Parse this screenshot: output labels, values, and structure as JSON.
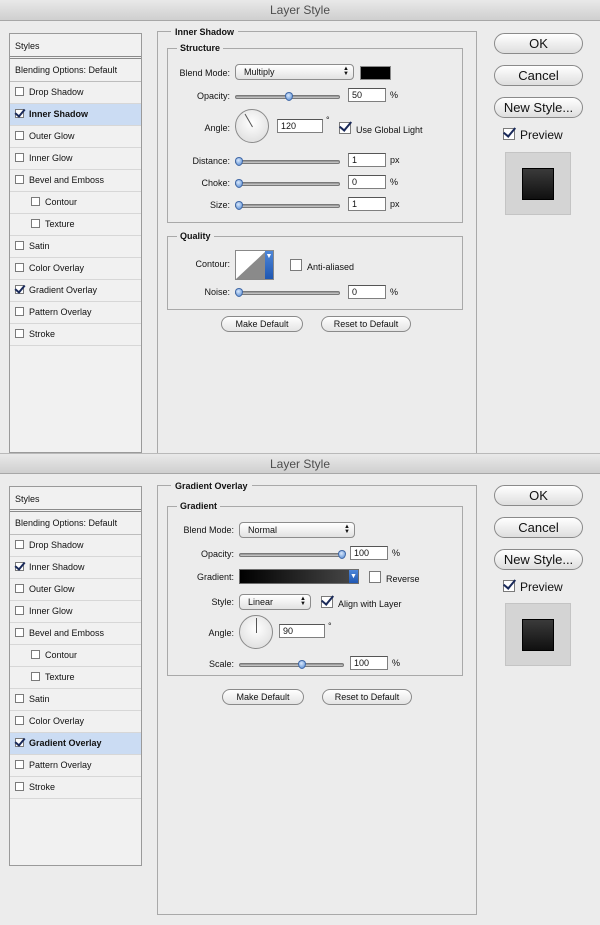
{
  "dialog1": {
    "title": "Layer Style",
    "styles": {
      "header": "Styles",
      "blending": "Blending Options: Default",
      "items": [
        {
          "label": "Drop Shadow",
          "checked": false
        },
        {
          "label": "Inner Shadow",
          "checked": true
        },
        {
          "label": "Outer Glow",
          "checked": false
        },
        {
          "label": "Inner Glow",
          "checked": false
        },
        {
          "label": "Bevel and Emboss",
          "checked": false
        },
        {
          "label": "Contour",
          "checked": false
        },
        {
          "label": "Texture",
          "checked": false
        },
        {
          "label": "Satin",
          "checked": false
        },
        {
          "label": "Color Overlay",
          "checked": false
        },
        {
          "label": "Gradient Overlay",
          "checked": true
        },
        {
          "label": "Pattern Overlay",
          "checked": false
        },
        {
          "label": "Stroke",
          "checked": false
        }
      ]
    },
    "panel_title": "Inner Shadow",
    "structure": {
      "title": "Structure",
      "blend_mode_label": "Blend Mode:",
      "blend_mode": "Multiply",
      "shadow_color": "#000000",
      "opacity_label": "Opacity:",
      "opacity": "50",
      "opacity_unit": "%",
      "opacity_value": 50,
      "angle_label": "Angle:",
      "angle": "120",
      "angle_unit": "°",
      "use_global_light": "Use Global Light",
      "distance_label": "Distance:",
      "distance": "1",
      "distance_unit": "px",
      "choke_label": "Choke:",
      "choke": "0",
      "choke_unit": "%",
      "size_label": "Size:",
      "size": "1",
      "size_unit": "px"
    },
    "quality": {
      "title": "Quality",
      "contour_label": "Contour:",
      "anti_aliased": "Anti-aliased",
      "noise_label": "Noise:",
      "noise": "0",
      "noise_unit": "%"
    },
    "make_default": "Make Default",
    "reset_to_default": "Reset to Default",
    "ok": "OK",
    "cancel": "Cancel",
    "new_style": "New Style...",
    "preview": "Preview"
  },
  "dialog2": {
    "title": "Layer Style",
    "styles": {
      "header": "Styles",
      "blending": "Blending Options: Default",
      "items": [
        {
          "label": "Drop Shadow",
          "checked": false
        },
        {
          "label": "Inner Shadow",
          "checked": true
        },
        {
          "label": "Outer Glow",
          "checked": false
        },
        {
          "label": "Inner Glow",
          "checked": false
        },
        {
          "label": "Bevel and Emboss",
          "checked": false
        },
        {
          "label": "Contour",
          "checked": false
        },
        {
          "label": "Texture",
          "checked": false
        },
        {
          "label": "Satin",
          "checked": false
        },
        {
          "label": "Color Overlay",
          "checked": false
        },
        {
          "label": "Gradient Overlay",
          "checked": true
        },
        {
          "label": "Pattern Overlay",
          "checked": false
        },
        {
          "label": "Stroke",
          "checked": false
        }
      ]
    },
    "panel_title": "Gradient Overlay",
    "gradient_group": {
      "title": "Gradient",
      "blend_mode_label": "Blend Mode:",
      "blend_mode": "Normal",
      "opacity_label": "Opacity:",
      "opacity": "100",
      "opacity_unit": "%",
      "opacity_value": 100,
      "gradient_label": "Gradient:",
      "gradient_start": "#000000",
      "gradient_end": "#4a4a4a",
      "reverse": "Reverse",
      "style_label": "Style:",
      "style": "Linear",
      "align_with_layer": "Align with Layer",
      "angle_label": "Angle:",
      "angle": "90",
      "angle_unit": "°",
      "scale_label": "Scale:",
      "scale": "100",
      "scale_unit": "%",
      "scale_value": 100
    },
    "make_default": "Make Default",
    "reset_to_default": "Reset to Default",
    "ok": "OK",
    "cancel": "Cancel",
    "new_style": "New Style...",
    "preview": "Preview"
  }
}
